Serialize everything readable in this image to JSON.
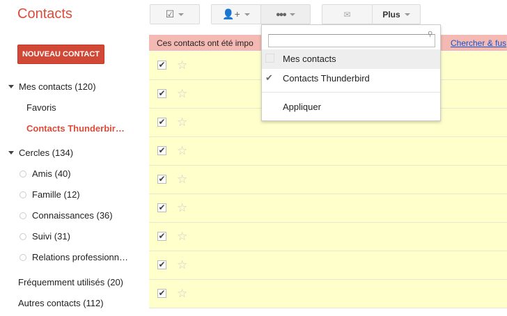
{
  "header": {
    "title": "Contacts",
    "more_label": "Plus"
  },
  "sidebar": {
    "new_contact": "NOUVEAU CONTACT",
    "my_contacts": "Mes contacts (120)",
    "favorites": "Favoris",
    "thunderbird": "Contacts Thunderbir…",
    "circles": "Cercles (134)",
    "circle_items": [
      {
        "label": "Amis (40)"
      },
      {
        "label": "Famille (12)"
      },
      {
        "label": "Connaissances (36)"
      },
      {
        "label": "Suivi (31)"
      },
      {
        "label": "Relations professionn…"
      }
    ],
    "frequent": "Fréquemment utilisés (20)",
    "others": "Autres contacts (112)"
  },
  "banner": {
    "text": "Ces contacts ont été impo",
    "suffix": ".",
    "link": "Chercher & fus"
  },
  "rows": [
    {
      "checked": true,
      "starred": false
    },
    {
      "checked": true,
      "starred": false
    },
    {
      "checked": true,
      "starred": false
    },
    {
      "checked": true,
      "starred": false
    },
    {
      "checked": true,
      "starred": false
    },
    {
      "checked": true,
      "starred": false
    },
    {
      "checked": true,
      "starred": false
    },
    {
      "checked": true,
      "starred": false
    },
    {
      "checked": true,
      "starred": false
    }
  ],
  "group_menu": {
    "search_value": "",
    "items": [
      {
        "label": "Mes contacts",
        "checked": false
      },
      {
        "label": "Contacts Thunderbird",
        "checked": true
      }
    ],
    "apply": "Appliquer"
  },
  "colors": {
    "accent": "#dd4b39",
    "banner": "#f4b9b2",
    "row": "#ffffcc"
  }
}
